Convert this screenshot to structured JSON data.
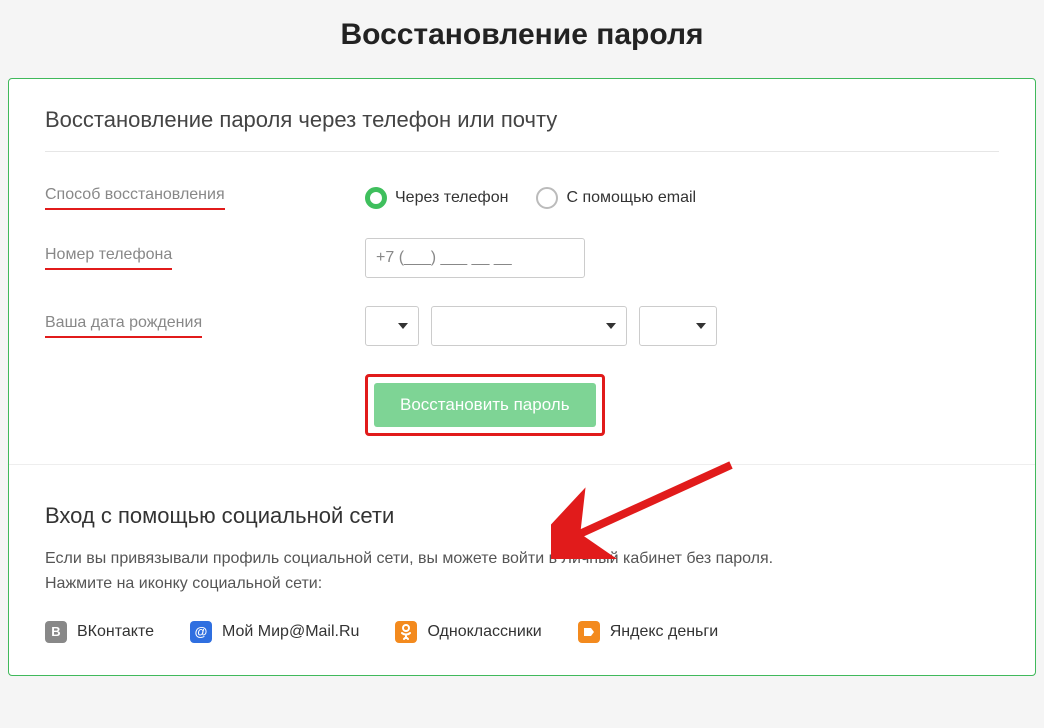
{
  "page_title": "Восстановление пароля",
  "form": {
    "title": "Восстановление пароля через телефон или почту",
    "labels": {
      "method": "Способ восстановления",
      "phone": "Номер телефона",
      "dob": "Ваша дата рождения"
    },
    "method_options": {
      "phone_label": "Через телефон",
      "email_label": "С помощью email",
      "selected": "phone"
    },
    "phone_placeholder": "+7 (___) ___ __ __",
    "submit_label": "Восстановить пароль"
  },
  "social": {
    "title": "Вход с помощью социальной сети",
    "desc_line1": "Если вы привязывали профиль социальной сети, вы можете войти в Личный кабинет без пароля.",
    "desc_line2": "Нажмите на иконку социальной сети:",
    "providers": {
      "vk": "ВКонтакте",
      "mm": "Мой Мир@Mail.Ru",
      "ok": "Одноклассники",
      "ya": "Яндекс деньги"
    }
  }
}
